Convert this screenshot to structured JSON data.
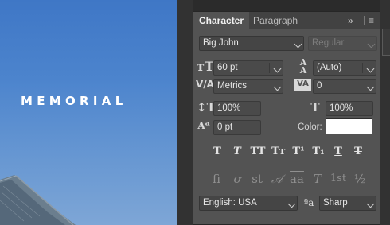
{
  "canvas": {
    "headline": "MEMORIAL",
    "sky_color": "#4c84cd"
  },
  "panel": {
    "tabs": [
      {
        "label": "Character",
        "active": true
      },
      {
        "label": "Paragraph",
        "active": false
      }
    ],
    "collapse_glyph": "»",
    "menu_glyph": "≡",
    "font_family": "Big John",
    "font_style": "Regular",
    "font_size": "60 pt",
    "leading": "(Auto)",
    "kerning": "Metrics",
    "tracking": "0",
    "vertical_scale": "100%",
    "horizontal_scale": "100%",
    "baseline_shift": "0 pt",
    "color_label": "Color:",
    "text_color": "#ffffff",
    "style_buttons": [
      {
        "name": "faux-bold",
        "glyph": "T"
      },
      {
        "name": "faux-italic",
        "glyph": "T"
      },
      {
        "name": "all-caps",
        "glyph": "TT"
      },
      {
        "name": "small-caps",
        "glyph": "Tт"
      },
      {
        "name": "superscript",
        "glyph": "T¹"
      },
      {
        "name": "subscript",
        "glyph": "T₁"
      },
      {
        "name": "underline",
        "glyph": "T"
      },
      {
        "name": "strikethrough",
        "glyph": "T"
      }
    ],
    "opentype_buttons": [
      {
        "name": "standard-ligatures",
        "glyph": "fi"
      },
      {
        "name": "contextual-alternates",
        "glyph": "ơ"
      },
      {
        "name": "discretionary-ligatures",
        "glyph": "st"
      },
      {
        "name": "swash",
        "glyph": "𝒜"
      },
      {
        "name": "stylistic-alternates",
        "glyph": "aa"
      },
      {
        "name": "titling-alternates",
        "glyph": "T"
      },
      {
        "name": "ordinals",
        "glyph": "1st"
      },
      {
        "name": "fractions",
        "glyph": "½"
      }
    ],
    "language": "English: USA",
    "antialias_glyph": "ªa",
    "antialias": "Sharp"
  }
}
